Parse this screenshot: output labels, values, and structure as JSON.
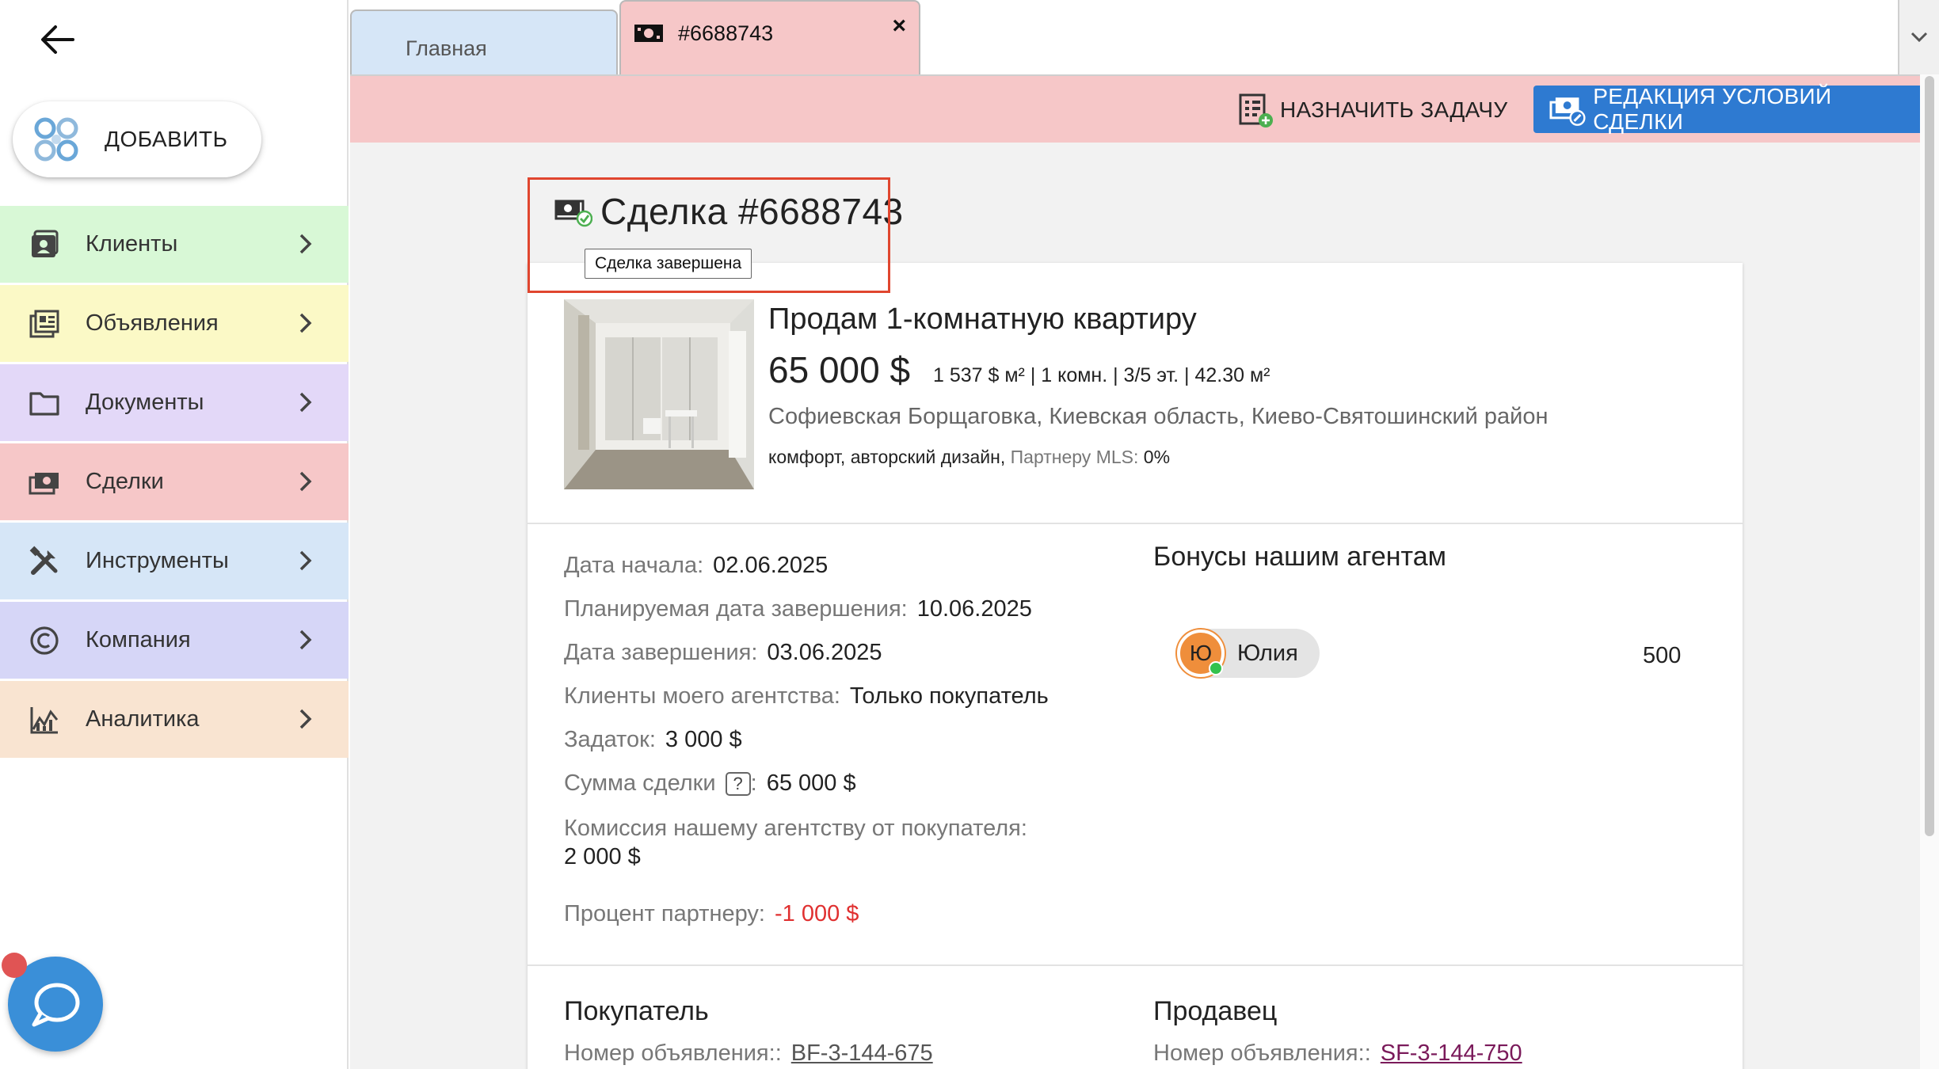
{
  "sidebar": {
    "add_label": "ДОБАВИТЬ",
    "items": [
      {
        "label": "Клиенты",
        "icon": "clients-icon",
        "color": "#d8f8d6"
      },
      {
        "label": "Объявления",
        "icon": "listings-icon",
        "color": "#fbf9c6"
      },
      {
        "label": "Документы",
        "icon": "folder-icon",
        "color": "#e3d8f8"
      },
      {
        "label": "Сделки",
        "icon": "deals-icon",
        "color": "#f6c7c8"
      },
      {
        "label": "Инструменты",
        "icon": "tools-icon",
        "color": "#d6e6f7"
      },
      {
        "label": "Компания",
        "icon": "copyright-icon",
        "color": "#d6d6f7"
      },
      {
        "label": "Аналитика",
        "icon": "analytics-icon",
        "color": "#f9e4d1"
      }
    ]
  },
  "tabs": {
    "home_label": "Главная",
    "deal_label": "#6688743",
    "close_label": "×"
  },
  "actions": {
    "assign_label": "НАЗНАЧИТЬ ЗАДАЧУ",
    "edit_label": "РЕДАКЦИЯ УСЛОВИЙ СДЕЛКИ"
  },
  "deal": {
    "title": "Сделка #6688743",
    "tooltip": "Сделка завершена"
  },
  "listing": {
    "title": "Продам 1-комнатную квартиру",
    "price": "65 000 $",
    "meta": "1 537 $ м² | 1 комн. | 3/5 эт. | 42.30 м²",
    "address": "Софиевская Борщаговка, Киевская область, Киево-Святошинский район",
    "tags": "комфорт, авторский дизайн,",
    "partner_label": "Партнеру MLS:",
    "partner_value": "0%"
  },
  "details": {
    "start_label": "Дата начала:",
    "start_value": "02.06.2025",
    "planned_label": "Планируемая дата завершения:",
    "planned_value": "10.06.2025",
    "end_label": "Дата завершения:",
    "end_value": "03.06.2025",
    "clients_label": "Клиенты моего агентства:",
    "clients_value": "Только покупатель",
    "deposit_label": "Задаток:",
    "deposit_value": "3 000 $",
    "sum_label": "Сумма сделки",
    "sum_help": "?",
    "sum_colon": ":",
    "sum_value": "65 000 $",
    "commission_label": "Комиссия нашему агентству от покупателя:",
    "commission_value": "2 000 $",
    "partner_pct_label": "Процент партнеру:",
    "partner_pct_value": "-1 000 $"
  },
  "bonuses": {
    "title": "Бонусы нашим агентам",
    "agent_initial": "Ю",
    "agent_name": "Юлия",
    "amount": "500"
  },
  "buyer": {
    "title": "Покупатель",
    "listing_label": "Номер объявления::",
    "listing_value": "BF-3-144-675"
  },
  "seller": {
    "title": "Продавец",
    "listing_label": "Номер объявления::",
    "listing_value": "SF-3-144-750"
  },
  "colors": {
    "accent": "#2e7ad1",
    "deal_tab": "#f6c7c8",
    "home_tab": "#d6e6f7",
    "negative": "#e03030",
    "highlight_box": "#e0462f"
  }
}
